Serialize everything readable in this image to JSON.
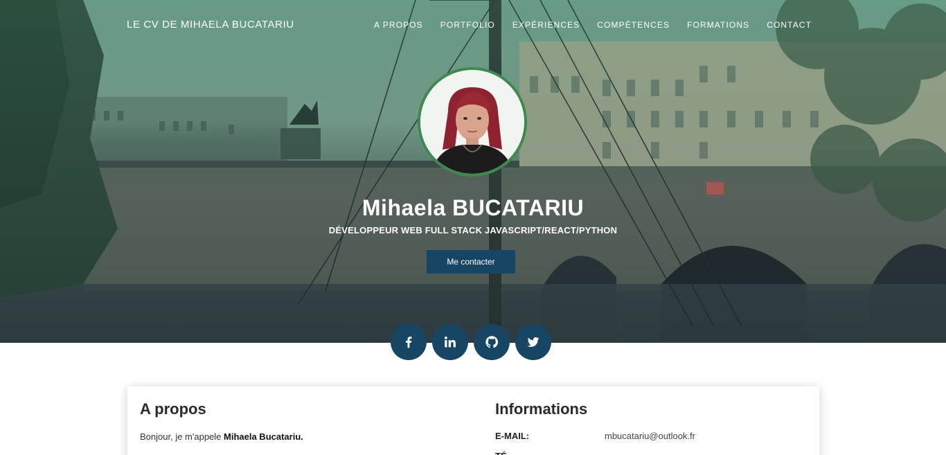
{
  "header": {
    "brand": "LE CV DE MIHAELA BUCATARIU",
    "nav": [
      "A PROPOS",
      "PORTFOLIO",
      "EXPÉRIENCES",
      "COMPÉTENCES",
      "FORMATIONS",
      "CONTACT"
    ]
  },
  "hero": {
    "name": "Mihaela BUCATARIU",
    "title": "DÉVELOPPEUR WEB FULL STACK JAVASCRIPT/REACT/PYTHON",
    "contact_button": "Me contacter"
  },
  "social": [
    {
      "icon": "facebook-icon",
      "glyph": "f"
    },
    {
      "icon": "linkedin-icon",
      "glyph": "in"
    },
    {
      "icon": "github-icon",
      "glyph": ""
    },
    {
      "icon": "twitter-icon",
      "glyph": ""
    }
  ],
  "about": {
    "heading": "A propos",
    "intro": "Bonjour, je m'appele ",
    "intro_name": "Mihaela Bucatariu."
  },
  "info": {
    "heading": "Informations",
    "email_label": "E-MAIL:",
    "email_value": "mbucatariu@outlook.fr",
    "phone_label": "TÉ"
  },
  "colors": {
    "primary": "#174665",
    "avatar_border": "#3c8a4e"
  }
}
